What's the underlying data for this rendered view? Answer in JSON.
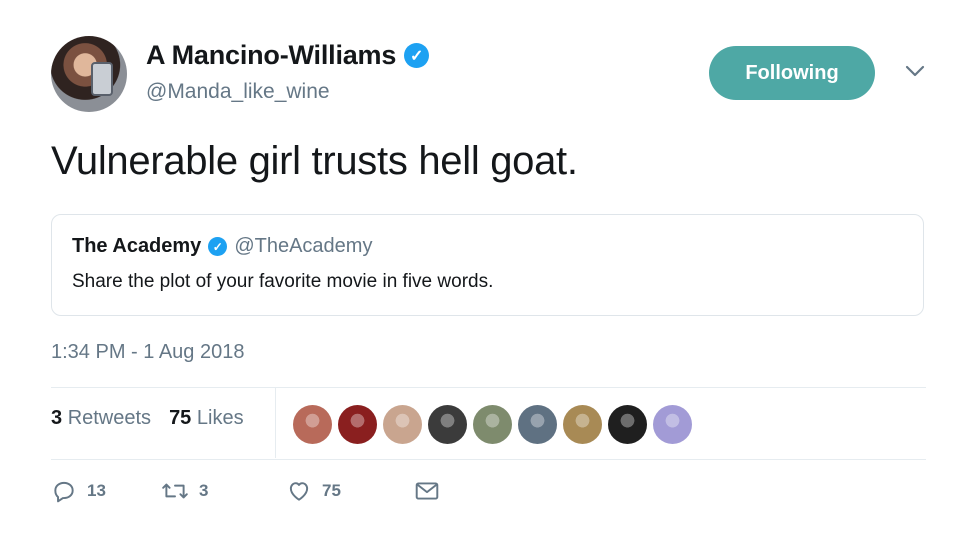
{
  "author": {
    "display_name": "A Mancino-Williams",
    "handle": "@Manda_like_wine",
    "verified": true
  },
  "follow_button": {
    "label": "Following",
    "color": "#4ea8a5"
  },
  "tweet": {
    "text": "Vulnerable girl trusts hell goat.",
    "timestamp": "1:34 PM - 1 Aug 2018"
  },
  "quoted_tweet": {
    "display_name": "The Academy",
    "handle": "@TheAcademy",
    "verified": true,
    "text": "Share the plot of your favorite movie in five words."
  },
  "stats": {
    "retweets_count": "3",
    "retweets_label": "Retweets",
    "likes_count": "75",
    "likes_label": "Likes"
  },
  "likers": [
    {
      "name": "liker-avatar-1",
      "color": "#b86a5a"
    },
    {
      "name": "liker-avatar-2",
      "color": "#8a1f1f"
    },
    {
      "name": "liker-avatar-3",
      "color": "#c9a58f"
    },
    {
      "name": "liker-avatar-4",
      "color": "#3b3b3b"
    },
    {
      "name": "liker-avatar-5",
      "color": "#7e8b6d"
    },
    {
      "name": "liker-avatar-6",
      "color": "#5f7182"
    },
    {
      "name": "liker-avatar-7",
      "color": "#a88a55"
    },
    {
      "name": "liker-avatar-8",
      "color": "#1f1f1f"
    },
    {
      "name": "liker-avatar-9",
      "color": "#a29bd6"
    }
  ],
  "actions": {
    "reply_count": "13",
    "retweet_count": "3",
    "like_count": "75"
  },
  "colors": {
    "accent": "#1da1f2",
    "muted": "#657786",
    "divider": "#e6ecf0"
  }
}
